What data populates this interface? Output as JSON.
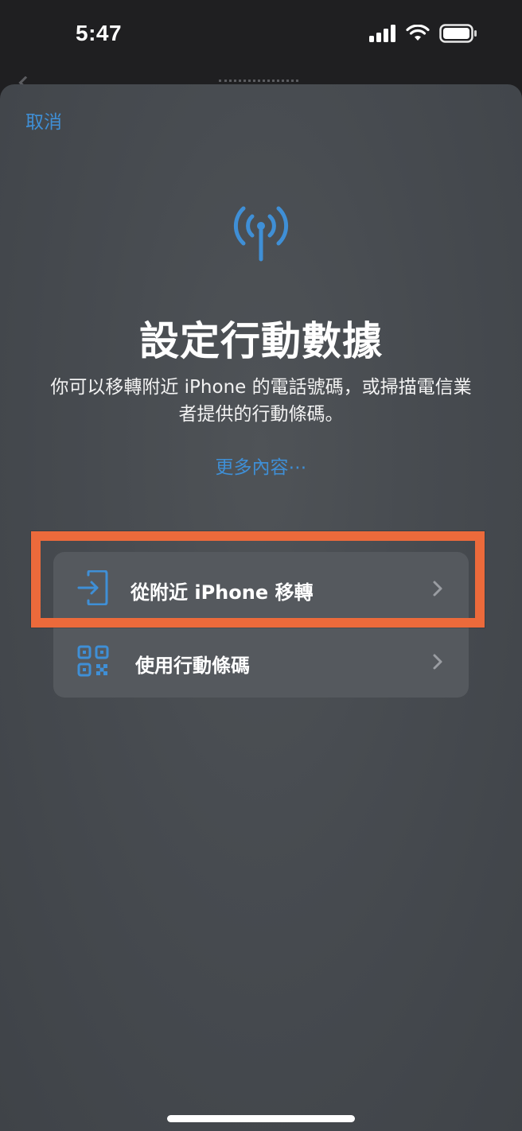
{
  "status_bar": {
    "time": "5:47",
    "icons": [
      "signal-icon",
      "wifi-icon",
      "battery-icon"
    ]
  },
  "sheet": {
    "cancel_label": "取消",
    "hero_icon": "antenna-icon",
    "title": "設定行動數據",
    "description": "你可以移轉附近 iPhone 的電話號碼，或掃描電信業者提供的行動條碼。",
    "more_link": "更多內容⋯"
  },
  "options": [
    {
      "icon": "transfer-icon",
      "label": "從附近 iPhone 移轉"
    },
    {
      "icon": "qr-code-icon",
      "label": "使用行動條碼"
    }
  ],
  "colors": {
    "accent": "#3f8fd6",
    "highlight": "#ec6a3b",
    "sheet_bg": "#474b50",
    "list_bg": "#55595e"
  }
}
